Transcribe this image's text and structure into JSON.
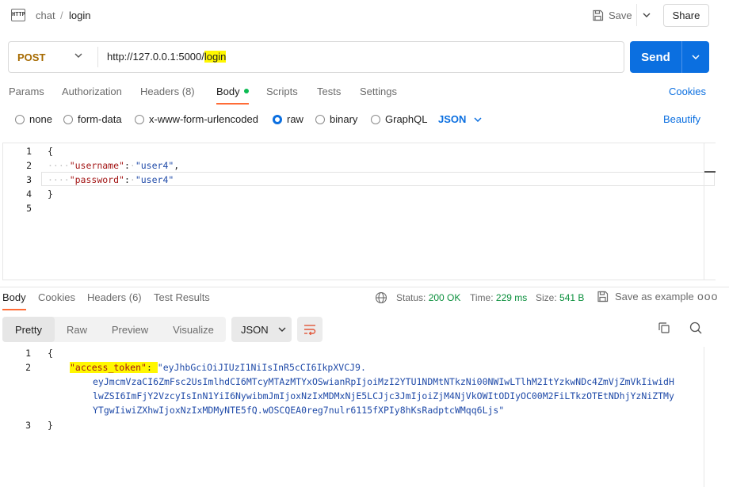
{
  "header": {
    "breadcrumb_parent": "chat",
    "breadcrumb_sep": "/",
    "breadcrumb_current": "login",
    "save_label": "Save",
    "share_label": "Share"
  },
  "request": {
    "method": "POST",
    "url_prefix": "http://127.0.0.1:5000/",
    "url_highlight": "login",
    "send_label": "Send"
  },
  "request_tabs": {
    "params": "Params",
    "authorization": "Authorization",
    "headers": "Headers (8)",
    "body": "Body",
    "scripts": "Scripts",
    "tests": "Tests",
    "settings": "Settings",
    "cookies": "Cookies"
  },
  "body_types": {
    "none": "none",
    "form_data": "form-data",
    "urlencoded": "x-www-form-urlencoded",
    "raw": "raw",
    "binary": "binary",
    "graphql": "GraphQL",
    "format": "JSON",
    "beautify": "Beautify",
    "selected": "raw"
  },
  "request_body": {
    "line_numbers": [
      "1",
      "2",
      "3",
      "4",
      "5"
    ],
    "open_brace": "{",
    "close_brace": "}",
    "indent": "····",
    "username_key": "\"username\"",
    "username_value": "\"user4\"",
    "password_key": "\"password\"",
    "password_value": "\"user4\""
  },
  "response_tabs": {
    "body": "Body",
    "cookies": "Cookies",
    "headers": "Headers (6)",
    "test_results": "Test Results"
  },
  "response_meta": {
    "status_label": "Status:",
    "status_value": "200 OK",
    "time_label": "Time:",
    "time_value": "229 ms",
    "size_label": "Size:",
    "size_value": "541 B",
    "save_example": "Save as example",
    "more": "ooo"
  },
  "response_view": {
    "pretty": "Pretty",
    "raw": "Raw",
    "preview": "Preview",
    "visualize": "Visualize",
    "format": "JSON"
  },
  "response_body": {
    "line_numbers": [
      "1",
      "2",
      "3"
    ],
    "open_brace": "{",
    "close_brace": "}",
    "token_key": "\"access_token\"",
    "token_lines": [
      "\"eyJhbGciOiJIUzI1NiIsInR5cCI6IkpXVCJ9.",
      "eyJmcmVzaCI6ZmFsc2UsImlhdCI6MTcyMTAzMTYxOSwianRpIjoiMzI2YTU1NDMtNTkzNi00NWIwLTlhM2ItYzkwNDc4ZmVjZmVkIiwidH",
      "lwZSI6ImFjY2VzcyIsInN1YiI6NywibmJmIjoxNzIxMDMxNjE5LCJjc3JmIjoiZjM4NjVkOWItODIyOC00M2FiLTkzOTEtNDhjYzNiZTMy",
      "YTgwIiwiZXhwIjoxNzIxMDMyNTE5fQ.wOSCQEA0reg7nulr6115fXPIy8hKsRadptcWMqq6Ljs\""
    ]
  },
  "colors": {
    "accent": "#0b6fe0",
    "method": "#a66a00",
    "active_tab": "#ff6c37",
    "status_ok": "#0a8f3c",
    "highlight": "#fff700"
  }
}
